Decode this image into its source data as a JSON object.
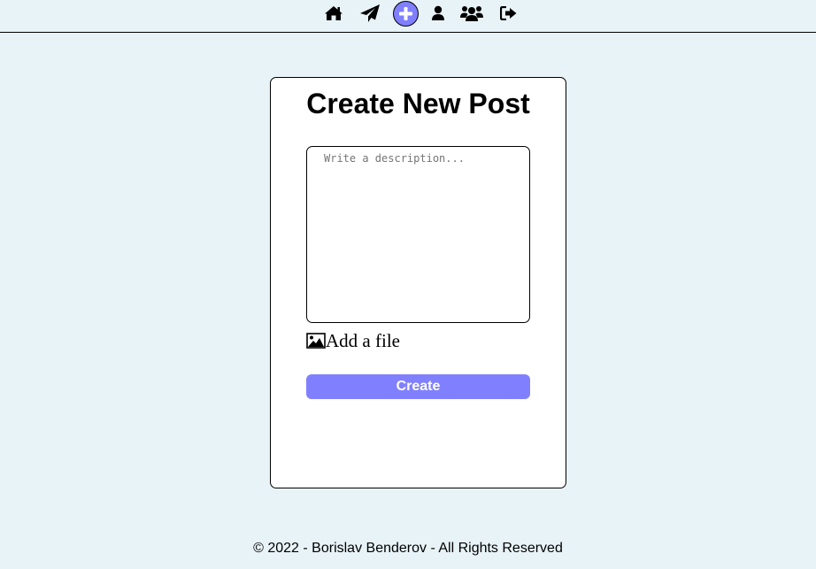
{
  "nav": {
    "items": [
      {
        "icon": "home-icon",
        "active": false
      },
      {
        "icon": "paper-plane-icon",
        "active": false
      },
      {
        "icon": "plus-icon",
        "active": true
      },
      {
        "icon": "user-icon",
        "active": false
      },
      {
        "icon": "users-icon",
        "active": false
      },
      {
        "icon": "sign-out-icon",
        "active": false
      }
    ],
    "active_color": "#8080ff"
  },
  "form": {
    "title": "Create New Post",
    "description_placeholder": "Write a description...",
    "description_value": "",
    "file_icon": "image-icon",
    "file_label": "Add a file",
    "submit_label": "Create"
  },
  "footer": {
    "text": "© 2022 - Borislav Benderov - All Rights Reserved"
  },
  "colors": {
    "background": "#e8f3f8",
    "accent": "#8080ff",
    "card": "#ffffff"
  }
}
